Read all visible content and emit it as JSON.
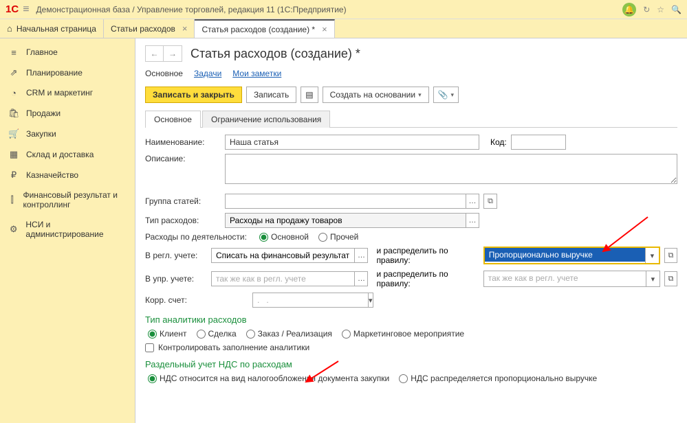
{
  "topbar": {
    "title": "Демонстрационная база / Управление торговлей, редакция 11  (1С:Предприятие)"
  },
  "tabs": {
    "home": "Начальная страница",
    "t1": "Статьи расходов",
    "t2": "Статья расходов (создание) *"
  },
  "sidebar": [
    {
      "icon": "≡",
      "label": "Главное"
    },
    {
      "icon": "⇗",
      "label": "Планирование"
    },
    {
      "icon": "◔",
      "label": "CRM и маркетинг"
    },
    {
      "icon": "🛍",
      "label": "Продажи"
    },
    {
      "icon": "🛒",
      "label": "Закупки"
    },
    {
      "icon": "▦",
      "label": "Склад и доставка"
    },
    {
      "icon": "₽",
      "label": "Казначейство"
    },
    {
      "icon": "⫿",
      "label": "Финансовый результат и контроллинг"
    },
    {
      "icon": "⚙",
      "label": "НСИ и администрирование"
    }
  ],
  "page": {
    "title": "Статья расходов (создание) *",
    "subnav": {
      "main": "Основное",
      "tasks": "Задачи",
      "notes": "Мои заметки"
    },
    "toolbar": {
      "save_close": "Записать и закрыть",
      "save": "Записать",
      "create_based": "Создать на основании"
    },
    "innertabs": {
      "t1": "Основное",
      "t2": "Ограничение использования"
    }
  },
  "form": {
    "name_lbl": "Наименование:",
    "name_val": "Наша статья",
    "code_lbl": "Код:",
    "desc_lbl": "Описание:",
    "group_lbl": "Группа статей:",
    "type_lbl": "Тип расходов:",
    "type_val": "Расходы на продажу товаров",
    "activity_lbl": "Расходы по деятельности:",
    "activity_r1": "Основной",
    "activity_r2": "Прочей",
    "regl_lbl": "В регл. учете:",
    "regl_val": "Списать на финансовый результат",
    "rule_lbl": "и распределить по правилу:",
    "rule_val": "Пропорционально выручке",
    "upr_lbl": "В упр. учете:",
    "upr_ph": "так же как в регл. учете",
    "rule2_ph": "так же как в регл. учете",
    "korr_lbl": "Корр. счет:",
    "korr_ph": ".   .",
    "analytics_title": "Тип аналитики расходов",
    "analytics": {
      "r1": "Клиент",
      "r2": "Сделка",
      "r3": "Заказ / Реализация",
      "r4": "Маркетинговое мероприятие"
    },
    "control_chk": "Контролировать заполнение аналитики",
    "nds_title": "Раздельный учет НДС по расходам",
    "nds": {
      "r1": "НДС относится на вид налогообложения документа закупки",
      "r2": "НДС распределяется пропорционально выручке"
    }
  }
}
